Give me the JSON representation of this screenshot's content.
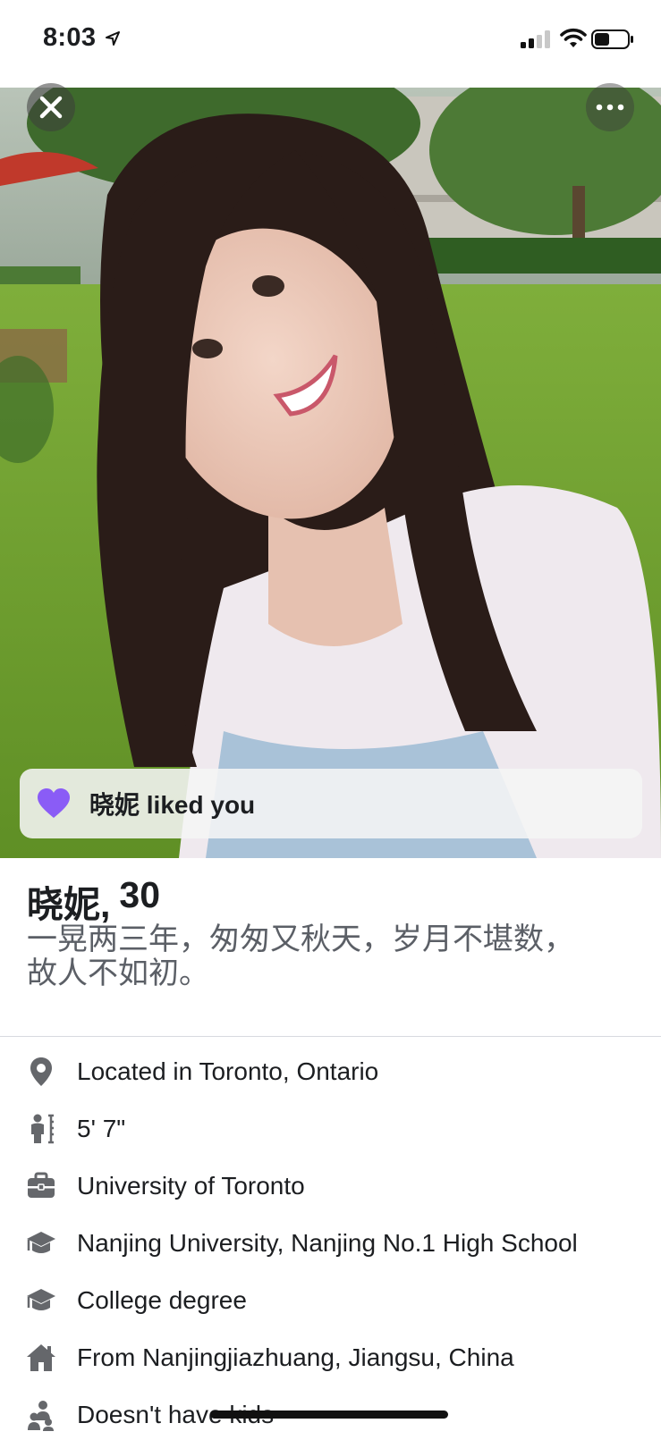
{
  "status_bar": {
    "time": "8:03"
  },
  "photo": {
    "close_icon": "close-icon",
    "more_icon": "more-icon"
  },
  "liked_banner": {
    "text": "晓妮 liked you",
    "icon": "heart-icon",
    "accent_color": "#8a5cf6"
  },
  "profile": {
    "name": "晓妮,",
    "age": "30",
    "bio_line1": "一晃两三年，匆匆又秋天，岁月不堪数，",
    "bio_line2": "故人不如初。"
  },
  "details": [
    {
      "icon": "location-pin-icon",
      "text": "Located in Toronto, Ontario"
    },
    {
      "icon": "height-icon",
      "text": "5' 7\""
    },
    {
      "icon": "briefcase-icon",
      "text": "University of Toronto"
    },
    {
      "icon": "graduation-cap-icon",
      "text": "Nanjing University, Nanjing No.1 High School"
    },
    {
      "icon": "graduation-cap-icon",
      "text": "College degree"
    },
    {
      "icon": "house-icon",
      "text": "From Nanjingjiazhuang, Jiangsu, China"
    },
    {
      "icon": "children-icon",
      "text": "Doesn't have kids"
    }
  ],
  "colors": {
    "icon_gray": "#65676b",
    "text_dark": "#1c1e21",
    "bio_gray": "#5b5f66"
  }
}
